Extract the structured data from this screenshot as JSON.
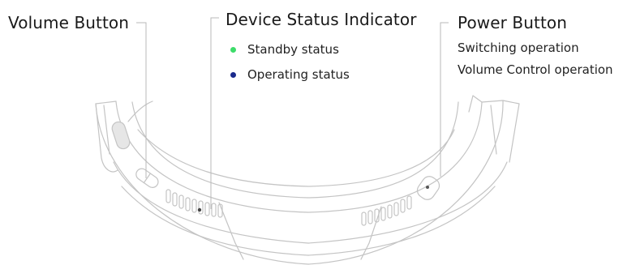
{
  "labels": {
    "volume_button": {
      "title": "Volume Button"
    },
    "status_indicator": {
      "title": "Device Status Indicator",
      "items": [
        {
          "text": "Standby status",
          "color": "#3ddc6a"
        },
        {
          "text": "Operating status",
          "color": "#1a2a8c"
        }
      ]
    },
    "power_button": {
      "title": "Power Button",
      "descriptions": [
        "Switching operation",
        "Volume Control operation"
      ]
    }
  },
  "colors": {
    "line": "#b9b9b9",
    "outline": "#c4c4c4"
  }
}
